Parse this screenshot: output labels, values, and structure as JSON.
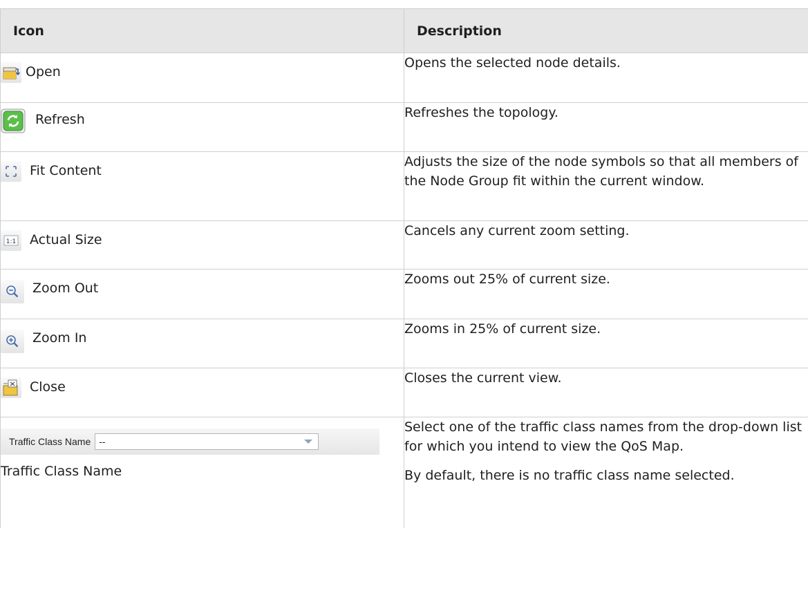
{
  "table": {
    "headers": {
      "icon": "Icon",
      "description": "Description"
    },
    "rows": [
      {
        "icon": "open-folder-icon",
        "label": "Open",
        "description": [
          "Opens the selected node details."
        ]
      },
      {
        "icon": "refresh-icon",
        "label": "Refresh",
        "description": [
          "Refreshes the topology."
        ]
      },
      {
        "icon": "fit-content-icon",
        "label": "Fit Content",
        "description": [
          "Adjusts the size of the node symbols so that all members of the Node Group fit within the current window."
        ]
      },
      {
        "icon": "actual-size-icon",
        "label": "Actual Size",
        "description": [
          "Cancels any current zoom setting."
        ]
      },
      {
        "icon": "zoom-out-icon",
        "label": "Zoom Out",
        "description": [
          "Zooms out 25% of current size."
        ]
      },
      {
        "icon": "zoom-in-icon",
        "label": "Zoom In",
        "description": [
          "Zooms in 25% of current size."
        ]
      },
      {
        "icon": "close-view-icon",
        "label": "Close",
        "description": [
          "Closes the current view."
        ]
      },
      {
        "widget": {
          "label": "Traffic Class Name",
          "value": "--"
        },
        "label": "Traffic Class Name",
        "description": [
          "Select one of the traffic class names from the drop-down list for which you intend to view the QoS Map.",
          "By default, there is no traffic class name selected."
        ]
      }
    ]
  },
  "colors": {
    "header_bg": "#e6e6e6",
    "border": "#cfcfcf",
    "refresh_green": "#3a9a3a",
    "folder_yellow": "#f0c540",
    "dropdown_arrow": "#8fa3bf"
  }
}
